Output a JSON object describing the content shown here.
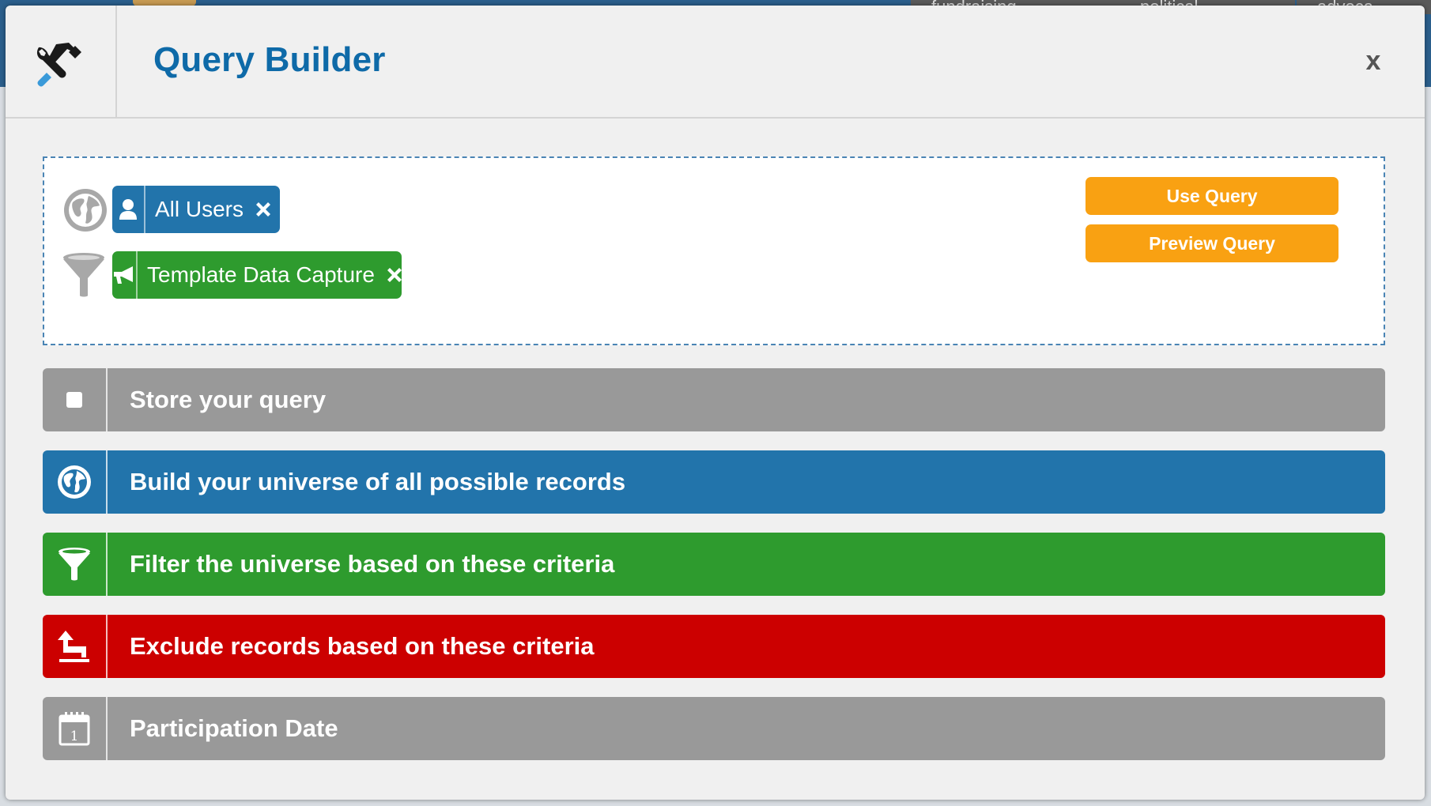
{
  "background": {
    "tabs": [
      "fundraising",
      "political",
      "advoca"
    ]
  },
  "modal": {
    "title": "Query Builder",
    "close_label": "x",
    "header_icon": "tools-icon"
  },
  "query": {
    "universe_chip": {
      "label": "All Users",
      "icon": "user-icon",
      "color": "#2274ab"
    },
    "filter_chip": {
      "label": "Template Data Capture",
      "icon": "megaphone-icon",
      "color": "#2e9b2e"
    },
    "use_query_label": "Use Query",
    "preview_query_label": "Preview Query"
  },
  "sections": [
    {
      "label": "Store your query",
      "icon": "square-icon",
      "color": "#999999"
    },
    {
      "label": "Build your universe of all possible records",
      "icon": "globe-icon",
      "color": "#2274ab"
    },
    {
      "label": "Filter the universe based on these criteria",
      "icon": "filter-icon",
      "color": "#2e9b2e"
    },
    {
      "label": "Exclude records based on these criteria",
      "icon": "exclude-arrow-icon",
      "color": "#cc0000"
    },
    {
      "label": "Participation Date",
      "icon": "calendar-icon",
      "color": "#999999"
    }
  ]
}
